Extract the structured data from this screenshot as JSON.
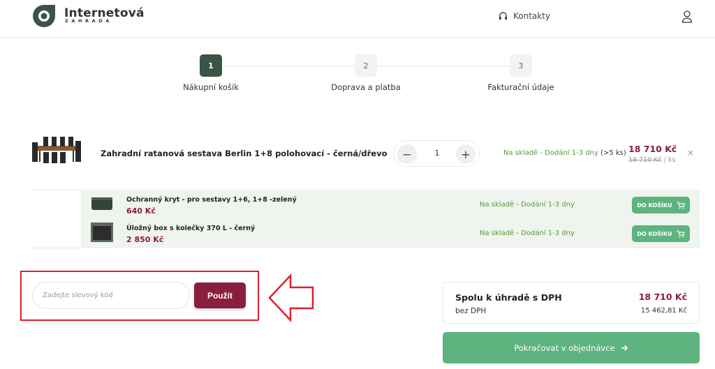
{
  "header": {
    "brand_name": "Internetová",
    "brand_sub": "ZAHRADA",
    "contacts_label": "Kontakty",
    "user_icon": "user-icon",
    "headset_icon": "headset-icon"
  },
  "steps": [
    {
      "number": "1",
      "label": "Nákupní košík",
      "active": true
    },
    {
      "number": "2",
      "label": "Doprava a platba",
      "active": false
    },
    {
      "number": "3",
      "label": "Fakturační údaje",
      "active": false
    }
  ],
  "cart_item": {
    "name": "Zahradní ratanová sestava Berlin 1+8 polohovací - černá/dřevo",
    "quantity": "1",
    "stock": "Na skladě - Dodání 1-3 dny",
    "stock_extra": "(>5 ks)",
    "price": "18 710 Kč",
    "old_price": "18 710 Kč",
    "unit": " / ks",
    "remove_symbol": "×"
  },
  "accessories": [
    {
      "name": "Ochranný kryt - pro sestavy 1+6, 1+8 -zelený",
      "price": "640 Kč",
      "stock": "Na skladě - Dodání 1-3 dny",
      "button": "DO KOŠÍKU"
    },
    {
      "name": "Úložný box s kolečky 370 L - černý",
      "price": "2 850 Kč",
      "stock": "Na skladě - Dodání 1-3 dny",
      "button": "DO KOŠÍKU"
    }
  ],
  "coupon": {
    "placeholder": "Zadejte slevový kód",
    "apply_label": "Použít"
  },
  "totals": {
    "label": "Spolu k úhradě s DPH",
    "value": "18 710 Kč",
    "sub_label": "bez DPH",
    "sub_value": "15 462,81 Kč"
  },
  "continue_label": "Pokračovat v objednávce",
  "colors": {
    "accent_green": "#5db47e",
    "dark_green": "#3a5446",
    "wine": "#8a1e3c",
    "highlight_red": "#e0202a"
  }
}
